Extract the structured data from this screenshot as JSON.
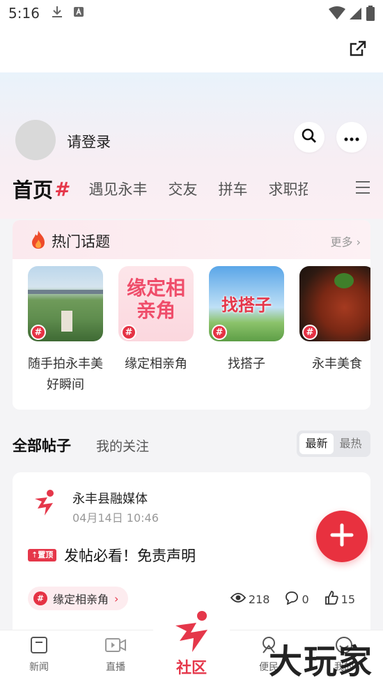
{
  "status_bar": {
    "time": "5:16"
  },
  "profile": {
    "login_text": "请登录"
  },
  "tabs": {
    "home": "首页",
    "items": [
      "遇见永丰",
      "交友",
      "拼车",
      "求职招"
    ]
  },
  "hot_topics": {
    "title": "热门话题",
    "more": "更多",
    "topics": [
      {
        "label": "随手拍永丰美好瞬间",
        "thumb_text": ""
      },
      {
        "label": "缘定相亲角",
        "thumb_text": "缘定相亲角"
      },
      {
        "label": "找搭子",
        "thumb_text": "找搭子"
      },
      {
        "label": "永丰美食",
        "thumb_text": ""
      }
    ]
  },
  "posts_section": {
    "all": "全部帖子",
    "follow": "我的关注",
    "sort_latest": "最新",
    "sort_hot": "最热"
  },
  "post": {
    "author": "永丰县融媒体",
    "date": "04月14日 10:46",
    "pin_label": "置顶",
    "title": "发帖必看！免责声明",
    "tag": "缘定相亲角",
    "views": "218",
    "comments": "0",
    "likes": "15"
  },
  "bottom_nav": {
    "news": "新闻",
    "live": "直播",
    "community": "社区",
    "services": "便民",
    "mine": "我的"
  },
  "watermark": "大玩家",
  "colors": {
    "accent": "#e5374a",
    "fab": "#e8313f"
  }
}
